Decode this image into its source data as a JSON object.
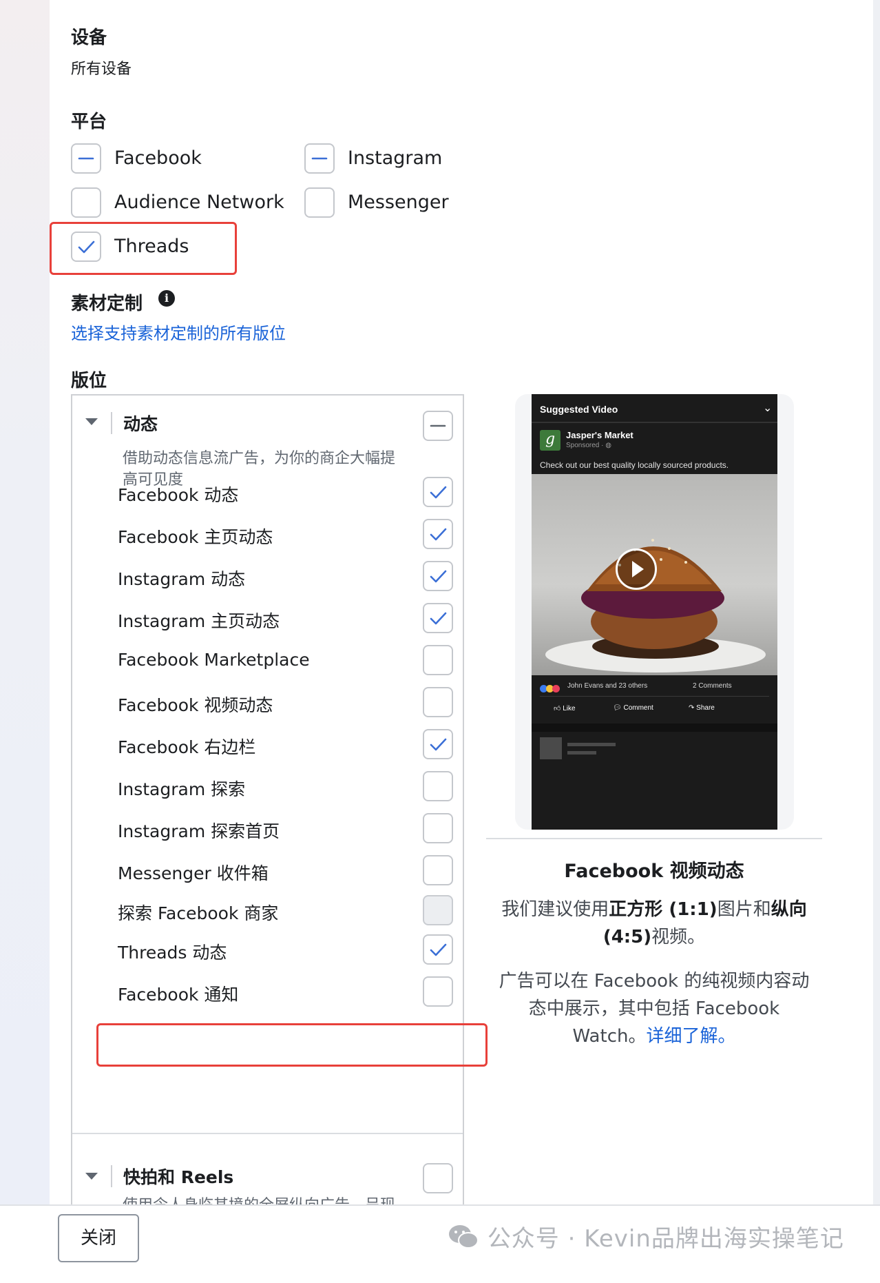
{
  "devices": {
    "heading": "设备",
    "value": "所有设备"
  },
  "platforms": {
    "heading": "平台",
    "items": [
      {
        "label": "Facebook",
        "state": "partial"
      },
      {
        "label": "Instagram",
        "state": "partial"
      },
      {
        "label": "Audience Network",
        "state": "unchecked"
      },
      {
        "label": "Messenger",
        "state": "unchecked"
      },
      {
        "label": "Threads",
        "state": "checked"
      }
    ]
  },
  "customization": {
    "heading": "素材定制",
    "info_icon": "info-icon",
    "link": "选择支持素材定制的所有版位"
  },
  "placements": {
    "heading": "版位",
    "feeds": {
      "title": "动态",
      "state": "partial",
      "description_lines": [
        "借助动态信息流广告，为你的商企大幅提",
        "高可见度"
      ],
      "items": [
        {
          "label": "Facebook 动态",
          "state": "checked"
        },
        {
          "label": "Facebook 主页动态",
          "state": "checked"
        },
        {
          "label": "Instagram 动态",
          "state": "checked"
        },
        {
          "label": "Instagram 主页动态",
          "state": "checked"
        },
        {
          "label": "Facebook Marketplace",
          "state": "unchecked"
        },
        {
          "label": "Facebook 视频动态",
          "state": "unchecked"
        },
        {
          "label": "Facebook 右边栏",
          "state": "checked"
        },
        {
          "label": "Instagram 探索",
          "state": "unchecked"
        },
        {
          "label": "Instagram 探索首页",
          "state": "unchecked"
        },
        {
          "label": "Messenger 收件箱",
          "state": "unchecked"
        },
        {
          "label": "探索 Facebook 商家",
          "state": "disabled"
        },
        {
          "label": "Threads 动态",
          "state": "checked"
        },
        {
          "label": "Facebook 通知",
          "state": "unchecked"
        }
      ]
    },
    "reels": {
      "title": "快拍和 Reels",
      "state": "unchecked",
      "description": "使用令人身临其境的全屏纵向广告，呈现"
    }
  },
  "preview": {
    "phone": {
      "header": "Suggested Video",
      "page_name": "Jasper's Market",
      "sponsored": "Sponsored · ",
      "logo_letter": "g",
      "caption": "Check out our best quality locally sourced products.",
      "reactions_text": "John Evans and 23 others",
      "comments": "2 Comments",
      "actions": [
        "Like",
        "Comment",
        "Share"
      ]
    },
    "title": "Facebook 视频动态",
    "para1_parts": [
      "我们建议使用",
      "正方形 (1:1)",
      "图片和",
      "纵向",
      "(4:5)",
      "视频。"
    ],
    "para2_lines": [
      "广告可以在 Facebook 的纯视频内容动",
      "态中展示，其中包括 Facebook"
    ],
    "para2_last": "Watch。",
    "learn_more": "详细了解。"
  },
  "footer": {
    "close_label": "关闭",
    "watermark": "公众号 · Kevin品牌出海实操笔记",
    "wechat_icon": "wechat-icon"
  },
  "colors": {
    "accent": "#1a63d8",
    "highlight": "#e8403a",
    "check_blue": "#3b6fd6"
  }
}
